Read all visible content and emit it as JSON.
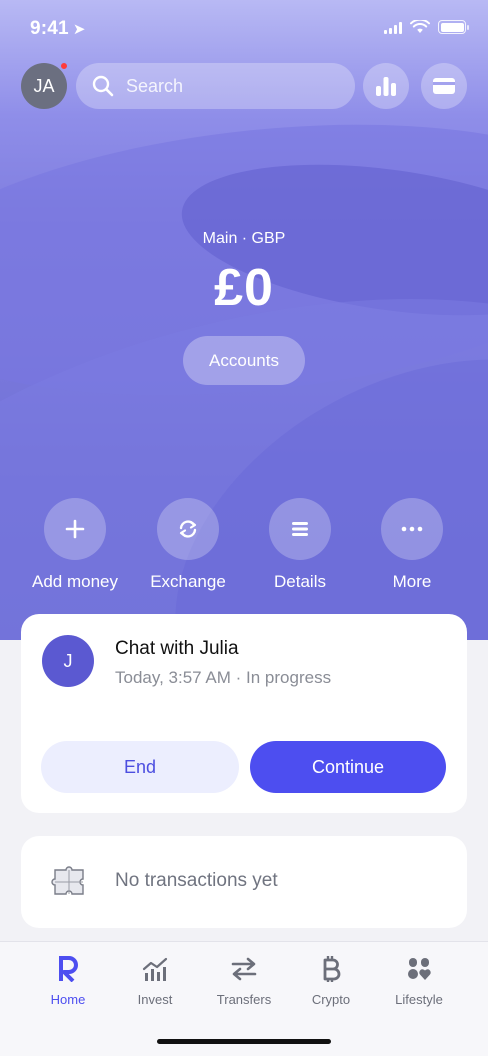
{
  "status_bar": {
    "time": "9:41"
  },
  "header": {
    "avatar_initials": "JA",
    "search_placeholder": "Search",
    "stats_icon": "bar-chart-icon",
    "card_icon": "card-icon"
  },
  "balance": {
    "account_label": "Main · GBP",
    "amount": "£0",
    "accounts_button": "Accounts"
  },
  "actions": [
    {
      "label": "Add money",
      "icon": "plus-icon"
    },
    {
      "label": "Exchange",
      "icon": "exchange-icon"
    },
    {
      "label": "Details",
      "icon": "details-icon"
    },
    {
      "label": "More",
      "icon": "more-icon"
    }
  ],
  "chat_card": {
    "avatar_initial": "J",
    "title": "Chat with Julia",
    "subtitle": "Today, 3:57 AM · In progress",
    "end_label": "End",
    "continue_label": "Continue"
  },
  "transactions": {
    "empty_text": "No transactions yet",
    "icon": "puzzle-icon"
  },
  "tabbar": {
    "active": "Home",
    "tabs": [
      {
        "label": "Home",
        "icon": "revolut-r-icon"
      },
      {
        "label": "Invest",
        "icon": "invest-chart-icon"
      },
      {
        "label": "Transfers",
        "icon": "transfer-arrows-icon"
      },
      {
        "label": "Crypto",
        "icon": "bitcoin-icon"
      },
      {
        "label": "Lifestyle",
        "icon": "lifestyle-icon"
      }
    ]
  },
  "colors": {
    "accent": "#4d4ef0",
    "hero": "#7f7ddf",
    "chat_avatar": "#5b59d1",
    "notification_dot": "#ff3b3b"
  }
}
